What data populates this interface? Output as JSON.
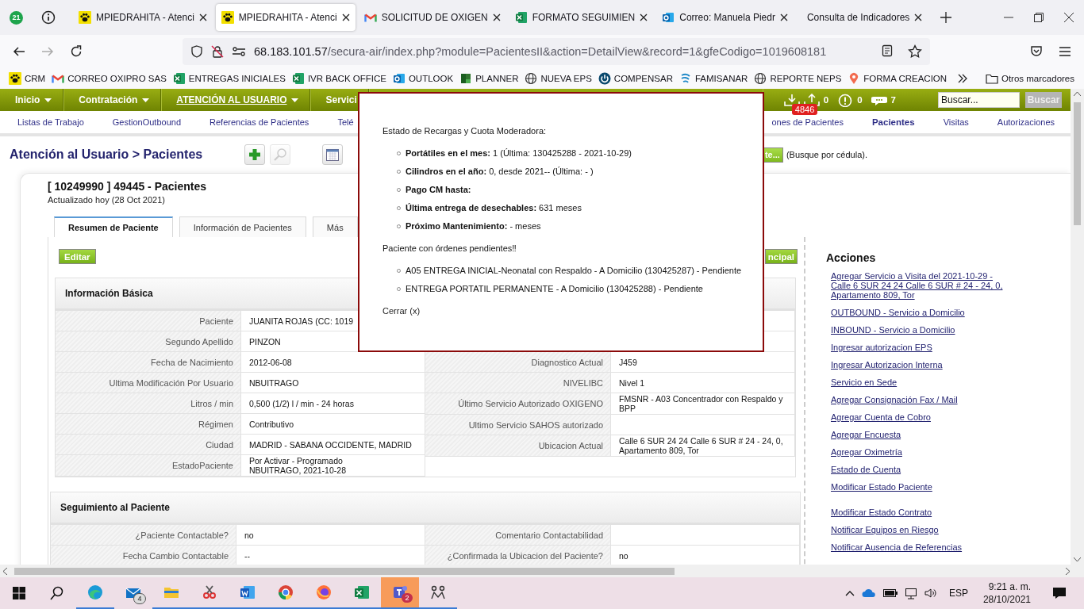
{
  "browser": {
    "notification_badge": "21",
    "tabs": [
      {
        "title": "MPIEDRAHITA - Atenci",
        "kind": "paw",
        "selected": false
      },
      {
        "title": "MPIEDRAHITA - Atenci",
        "kind": "paw",
        "selected": true
      },
      {
        "title": "SOLICITUD DE OXIGEN",
        "kind": "gmail",
        "selected": false
      },
      {
        "title": "FORMATO SEGUIMIEN",
        "kind": "excel",
        "selected": false
      },
      {
        "title": "Correo: Manuela Piedr",
        "kind": "outlook",
        "selected": false
      },
      {
        "title": "Consulta de Indicadores",
        "kind": "none",
        "selected": false
      }
    ],
    "address": {
      "host": "68.183.101.57",
      "path": "/secura-air/index.php?module=PacientesII&action=DetailView&record=1&gfeCodigo=1019608181"
    },
    "bookmarks": [
      {
        "label": "CRM",
        "kind": "paw"
      },
      {
        "label": "CORREO OXIPRO SAS",
        "kind": "gmail"
      },
      {
        "label": "ENTREGAS INICIALES",
        "kind": "excel"
      },
      {
        "label": "IVR BACK OFFICE",
        "kind": "excel"
      },
      {
        "label": "OUTLOOK",
        "kind": "outlook"
      },
      {
        "label": "PLANNER",
        "kind": "planner"
      },
      {
        "label": "NUEVA EPS",
        "kind": "globe"
      },
      {
        "label": "COMPENSAR",
        "kind": "power"
      },
      {
        "label": "FAMISANAR",
        "kind": "swirl"
      },
      {
        "label": "REPORTE NEPS",
        "kind": "globe"
      },
      {
        "label": "FORMA CREACION",
        "kind": "pin"
      }
    ],
    "other_bookmarks": "Otros marcadores"
  },
  "app": {
    "menu": [
      {
        "label": "Inicio",
        "selected": false
      },
      {
        "label": "Contratación",
        "selected": false
      },
      {
        "label": "ATENCIÓN AL USUARIO",
        "selected": true
      },
      {
        "label": "Servici",
        "selected": false
      }
    ],
    "indicators": [
      {
        "kind": "inbox",
        "badge": "4846"
      },
      {
        "kind": "outbox",
        "count": "0"
      },
      {
        "kind": "alert",
        "count": "0"
      },
      {
        "kind": "chat",
        "count": "7"
      }
    ],
    "search": {
      "placeholder": "Buscar...",
      "button": "Buscar"
    },
    "subnav_left": [
      {
        "label": "Listas de Trabajo",
        "selected": false
      },
      {
        "label": "GestionOutbound",
        "selected": false
      },
      {
        "label": "Referencias de Pacientes",
        "selected": false
      },
      {
        "label": "Telé",
        "selected": false
      }
    ],
    "subnav_right": [
      {
        "label": "ones de Pacientes",
        "selected": false
      },
      {
        "label": "Pacientes",
        "selected": true
      },
      {
        "label": "Visitas",
        "selected": false
      },
      {
        "label": "Autorizaciones",
        "selected": false
      }
    ],
    "breadcrumb": "Atención al Usuario > Pacientes",
    "search_button": "te...",
    "search_hint": "(Busque por cédula).",
    "record": {
      "title": "[ 10249990 ] 49445 - Pacientes",
      "updated": "Actualizado hoy (28 Oct 2021)"
    },
    "tabs": [
      {
        "label": "Resumen de Paciente",
        "selected": true
      },
      {
        "label": "Información de Pacientes",
        "selected": false
      },
      {
        "label": "Más",
        "selected": false
      }
    ],
    "edit_button": "Editar",
    "main_button": "ncipal",
    "sections": [
      {
        "title": "Información Básica",
        "left": [
          {
            "label": "Paciente",
            "value": "JUANITA ROJAS (CC: 1019"
          },
          {
            "label": "Segundo Apellido",
            "value": " PINZON"
          },
          {
            "label": "Fecha de Nacimiento",
            "value": "2012-06-08"
          },
          {
            "label": "Ultima Modificación Por Usuario",
            "value": " NBUITRAGO"
          },
          {
            "label": "Litros / min",
            "value": " 0,500 (1/2) l / min - 24 horas"
          },
          {
            "label": "Régimen",
            "value": " Contributivo"
          },
          {
            "label": "Ciudad",
            "value": " MADRID - SABANA OCCIDENTE, MADRID"
          },
          {
            "label": "EstadoPaciente",
            "value": " Por Activar - Programado\n NBUITRAGO, 2021-10-28"
          }
        ],
        "right": [
          {
            "label": "Diagnostico Actual",
            "value": "J459"
          },
          {
            "label": "NIVELIBC",
            "value": " Nivel 1"
          },
          {
            "label": "Último Servicio Autorizado OXIGENO",
            "value": "FMSNR - A03 Concentrador con Respaldo y BPP"
          },
          {
            "label": "Ultimo Servicio SAHOS autorizado"
          },
          {
            "label": "Ubicacion Actual",
            "value": "Calle 6 SUR 24 24 Calle 6 SUR # 24 - 24, 0, Apartamento 809, Tor"
          }
        ]
      },
      {
        "title": "Seguimiento al Paciente",
        "left": [
          {
            "label": "¿Paciente Contactable?",
            "value": "no"
          },
          {
            "label": "Fecha Cambio Contactable",
            "value": "--"
          }
        ],
        "right": [
          {
            "label": "Comentario Contactabilidad"
          },
          {
            "label": "¿Confirmada la Ubicacion del Paciente?",
            "value": "no"
          }
        ]
      }
    ],
    "actions": {
      "title": "Acciones",
      "link_groups": [
        [
          "Agregar Servicio a Visita del 2021-10-29 - Calle 6 SUR 24 24 Calle 6 SUR # 24 - 24, 0, Apartamento 809, Tor",
          "OUTBOUND - Servicio a Domicilio",
          "INBOUND - Servicio a Domicilio",
          "Ingresar autorizacion EPS",
          "Ingresar Autorizacion Interna",
          "Servicio en Sede",
          "Agregar Consignación Fax / Mail",
          "Agregar Cuenta de Cobro",
          "Agregar Encuesta",
          "Agregar Oximetría",
          "Estado de Cuenta",
          "Modificar Estado Paciente"
        ],
        [
          "Modificar Estado Contrato",
          "Notificar Equipos en Riesgo",
          "Notificar Ausencia de Referencias"
        ]
      ]
    }
  },
  "popup": {
    "heading": "Estado de Recargas y Cuota Moderadora:",
    "status_items": [
      "**Portátiles en el mes:** 1 (Última: 130425288 - 2021-10-29)",
      "**Cilindros en el año:** 0, desde 2021-- (Última: - )",
      "**Pago CM hasta:**",
      "**Última entrega de desechables:** 631 meses",
      "**Próximo Mantenimiento:** - meses"
    ],
    "orders_heading": "Paciente con órdenes pendientes‼",
    "orders": [
      "A05 ENTREGA INICIAL-Neonatal con Respaldo - A Domicilio (130425287) - Pendiente",
      "ENTREGA PORTATIL PERMANENTE - A Domicilio (130425288) - Pendiente"
    ],
    "close_link": "Cerrar (x)"
  },
  "taskbar": {
    "apps": [
      {
        "kind": "edge",
        "open": true,
        "highlighted": false
      },
      {
        "kind": "mail",
        "badge": "4",
        "open": false,
        "highlighted": false
      },
      {
        "kind": "folder",
        "open": true,
        "highlighted": false
      },
      {
        "kind": "snip",
        "open": true,
        "highlighted": false
      },
      {
        "kind": "word",
        "open": true,
        "highlighted": false
      },
      {
        "kind": "chrome",
        "open": true,
        "highlighted": false
      },
      {
        "kind": "firefox",
        "open": true,
        "highlighted": false
      },
      {
        "kind": "excel",
        "open": true,
        "highlighted": false
      },
      {
        "kind": "teams",
        "badge": "2",
        "open": true,
        "highlighted": true
      },
      {
        "kind": "network",
        "open": true,
        "highlighted": false
      }
    ],
    "language": "ESP",
    "time": "9:21 a. m.",
    "date": "28/10/2021"
  }
}
